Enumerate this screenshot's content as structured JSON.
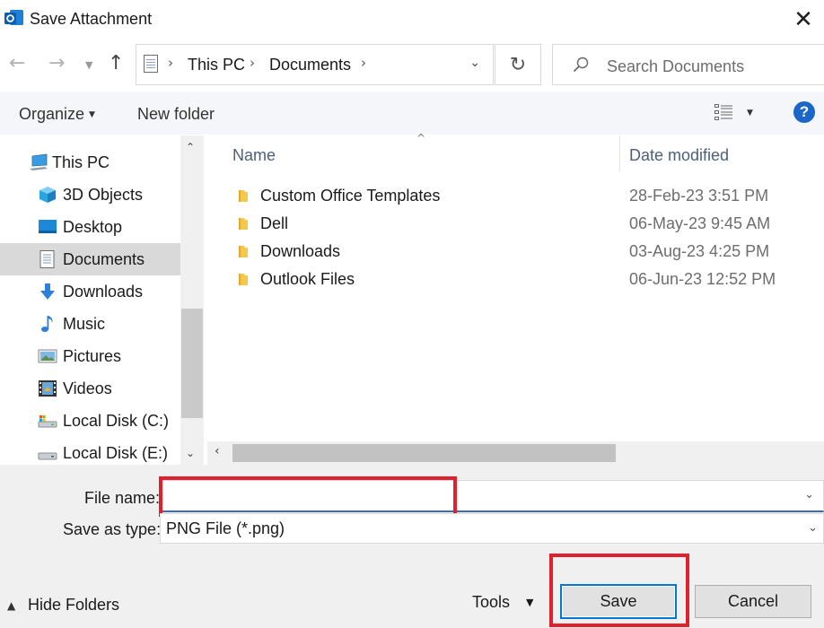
{
  "window": {
    "title": "Save Attachment",
    "app_icon": "outlook-icon",
    "close_icon": "close-icon"
  },
  "nav": {
    "back_icon": "arrow-left-icon",
    "forward_icon": "arrow-right-icon",
    "recent_icon": "chevron-down-icon",
    "up_icon": "arrow-up-icon",
    "breadcrumbs": [
      "This PC",
      "Documents"
    ],
    "refresh_icon": "refresh-icon",
    "search_placeholder": "Search Documents"
  },
  "toolbar": {
    "organize_label": "Organize",
    "new_folder_label": "New folder",
    "view_icon": "view-options-icon",
    "help_icon": "help-icon",
    "help_glyph": "?"
  },
  "sidebar": {
    "items": [
      {
        "label": "This PC",
        "icon": "computer-icon",
        "selected": false
      },
      {
        "label": "3D Objects",
        "icon": "cube-icon",
        "selected": false
      },
      {
        "label": "Desktop",
        "icon": "desktop-icon",
        "selected": false
      },
      {
        "label": "Documents",
        "icon": "document-icon",
        "selected": true
      },
      {
        "label": "Downloads",
        "icon": "download-arrow-icon",
        "selected": false
      },
      {
        "label": "Music",
        "icon": "music-note-icon",
        "selected": false
      },
      {
        "label": "Pictures",
        "icon": "picture-icon",
        "selected": false
      },
      {
        "label": "Videos",
        "icon": "film-icon",
        "selected": false
      },
      {
        "label": "Local Disk (C:)",
        "icon": "drive-icon",
        "selected": false
      },
      {
        "label": "Local Disk (E:)",
        "icon": "drive-icon",
        "selected": false
      }
    ]
  },
  "filelist": {
    "columns": {
      "name": "Name",
      "date_modified": "Date modified"
    },
    "rows": [
      {
        "name": "Custom Office Templates",
        "date": "28-Feb-23 3:51 PM"
      },
      {
        "name": "Dell",
        "date": "06-May-23 9:45 AM"
      },
      {
        "name": "Downloads",
        "date": "03-Aug-23 4:25 PM"
      },
      {
        "name": "Outlook Files",
        "date": "06-Jun-23 12:52 PM"
      }
    ]
  },
  "form": {
    "file_name_label": "File name:",
    "file_name_value": "",
    "save_as_type_label": "Save as type:",
    "save_as_type_value": "PNG File (*.png)"
  },
  "footer": {
    "hide_folders_label": "Hide Folders",
    "tools_label": "Tools",
    "save_label": "Save",
    "cancel_label": "Cancel"
  },
  "colors": {
    "accent": "#0078d7",
    "highlight": "#e0202c",
    "help_blue": "#1a66c9",
    "folder_yellow": "#f5c84c"
  }
}
